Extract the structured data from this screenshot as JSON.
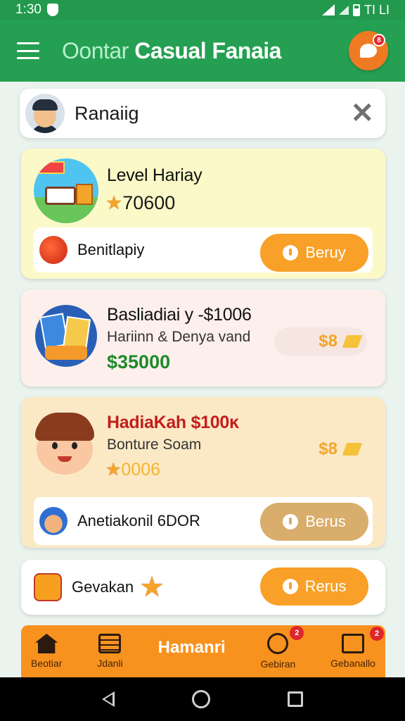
{
  "status_bar": {
    "time": "1:30",
    "right_text": "TI LI"
  },
  "app_bar": {
    "title_faded": "Oontar",
    "title_main": "Casual Fanaia",
    "chat_badge": "8"
  },
  "search": {
    "text": "Ranaiig"
  },
  "cards": [
    {
      "title": "Level Hariay",
      "amount": "70600",
      "row_label": "Benitlapiy",
      "button_label": "Beruy",
      "colors": {
        "bg": "#fbf9c8"
      }
    },
    {
      "title": "Basliadiai y -$1006",
      "subtitle": "Hariinn & Denya vand",
      "amount": "$35000",
      "price": "$8"
    },
    {
      "title": "HadiaKah $100ĸ",
      "subtitle": "Bonture Soam",
      "amount": "0006",
      "price": "$8",
      "row_label": "Anetiakonil 6DOR",
      "button_label": "Berus"
    },
    {
      "row_label": "Gevakan",
      "button_label": "Rerus"
    }
  ],
  "bottom_nav": {
    "items": [
      {
        "label": "Beotiar",
        "icon": "home-icon"
      },
      {
        "label": "Jdanli",
        "icon": "document-icon"
      },
      {
        "label": "Hamanri",
        "icon": ""
      },
      {
        "label": "Gebiran",
        "icon": "clock-icon",
        "badge": "2"
      },
      {
        "label": "Gebanallo",
        "icon": "bag-icon",
        "badge": "2"
      }
    ]
  },
  "colors": {
    "primary": "#25a052",
    "accent": "#f8a027",
    "price_green": "#1f8a2a",
    "title_red": "#c41e1e"
  }
}
